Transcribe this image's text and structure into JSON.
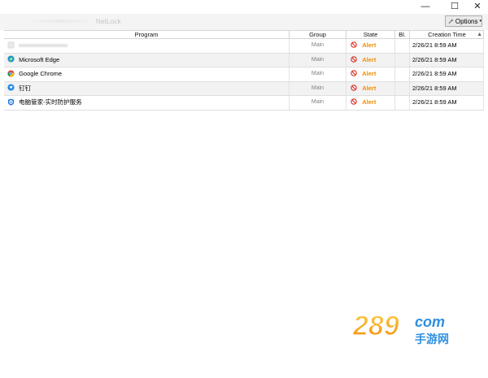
{
  "window": {
    "title": "NetLock",
    "controls": {
      "minimize": "—",
      "maximize": "☐",
      "close": "✕"
    }
  },
  "toolbar": {
    "options_label": "Options",
    "options_caret": "▾"
  },
  "table": {
    "columns": {
      "program": "Program",
      "group": "Group",
      "state": "State",
      "bl": "Bl.",
      "creation_time": "Creation Time"
    },
    "sort_indicator": "▲",
    "rows": [
      {
        "icon": "generic-app-icon",
        "program": "",
        "group": "Main",
        "state": "Alert",
        "bl": "",
        "time": "2/26/21 8:59 AM"
      },
      {
        "icon": "edge-icon",
        "program": "Microsoft Edge",
        "group": "Main",
        "state": "Alert",
        "bl": "",
        "time": "2/26/21 8:59 AM"
      },
      {
        "icon": "chrome-icon",
        "program": "Google Chrome",
        "group": "Main",
        "state": "Alert",
        "bl": "",
        "time": "2/26/21 8:59 AM"
      },
      {
        "icon": "dingtalk-icon",
        "program": "钉钉",
        "group": "Main",
        "state": "Alert",
        "bl": "",
        "time": "2/26/21 8:59 AM"
      },
      {
        "icon": "pc-manager-icon",
        "program": "电脑管家-实时防护服务",
        "group": "Main",
        "state": "Alert",
        "bl": "",
        "time": "2/26/21 8:59 AM"
      }
    ]
  },
  "watermark": {
    "text": "289",
    "suffix": "com",
    "subtext": "手游网"
  },
  "colors": {
    "alert": "#f08c00",
    "block": "#d93025",
    "row_alt": "#f2f2f2"
  }
}
